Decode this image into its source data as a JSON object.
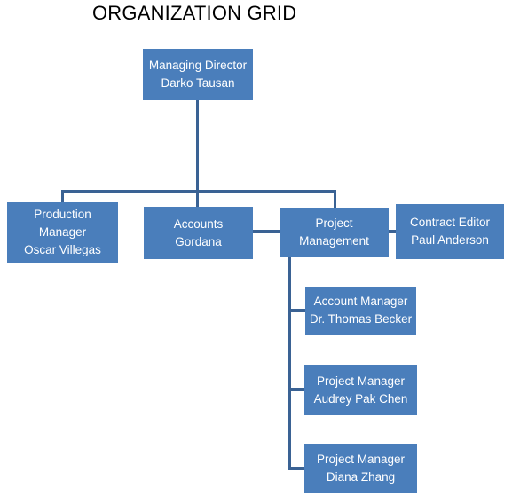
{
  "title": "ORGANIZATION GRID",
  "colors": {
    "node_fill": "#4A7EBB",
    "node_text": "#FFFFFF",
    "connector": "#3A6294",
    "title_text": "#000000",
    "background": "#FFFFFF"
  },
  "nodes": {
    "managing_director": {
      "role": "Managing Director",
      "person": "Darko Tausan"
    },
    "production_manager": {
      "role_line1": "Production",
      "role_line2": "Manager",
      "person": "Oscar Villegas"
    },
    "accounts": {
      "role": "Accounts",
      "person": "Gordana"
    },
    "project_management": {
      "role_line1": "Project",
      "role_line2": "Management"
    },
    "contract_editor": {
      "role": "Contract Editor",
      "person": "Paul Anderson"
    },
    "account_manager": {
      "role": "Account Manager",
      "person": "Dr. Thomas Becker"
    },
    "project_manager_1": {
      "role": "Project Manager",
      "person": "Audrey Pak Chen"
    },
    "project_manager_2": {
      "role": "Project Manager",
      "person": "Diana Zhang"
    }
  }
}
